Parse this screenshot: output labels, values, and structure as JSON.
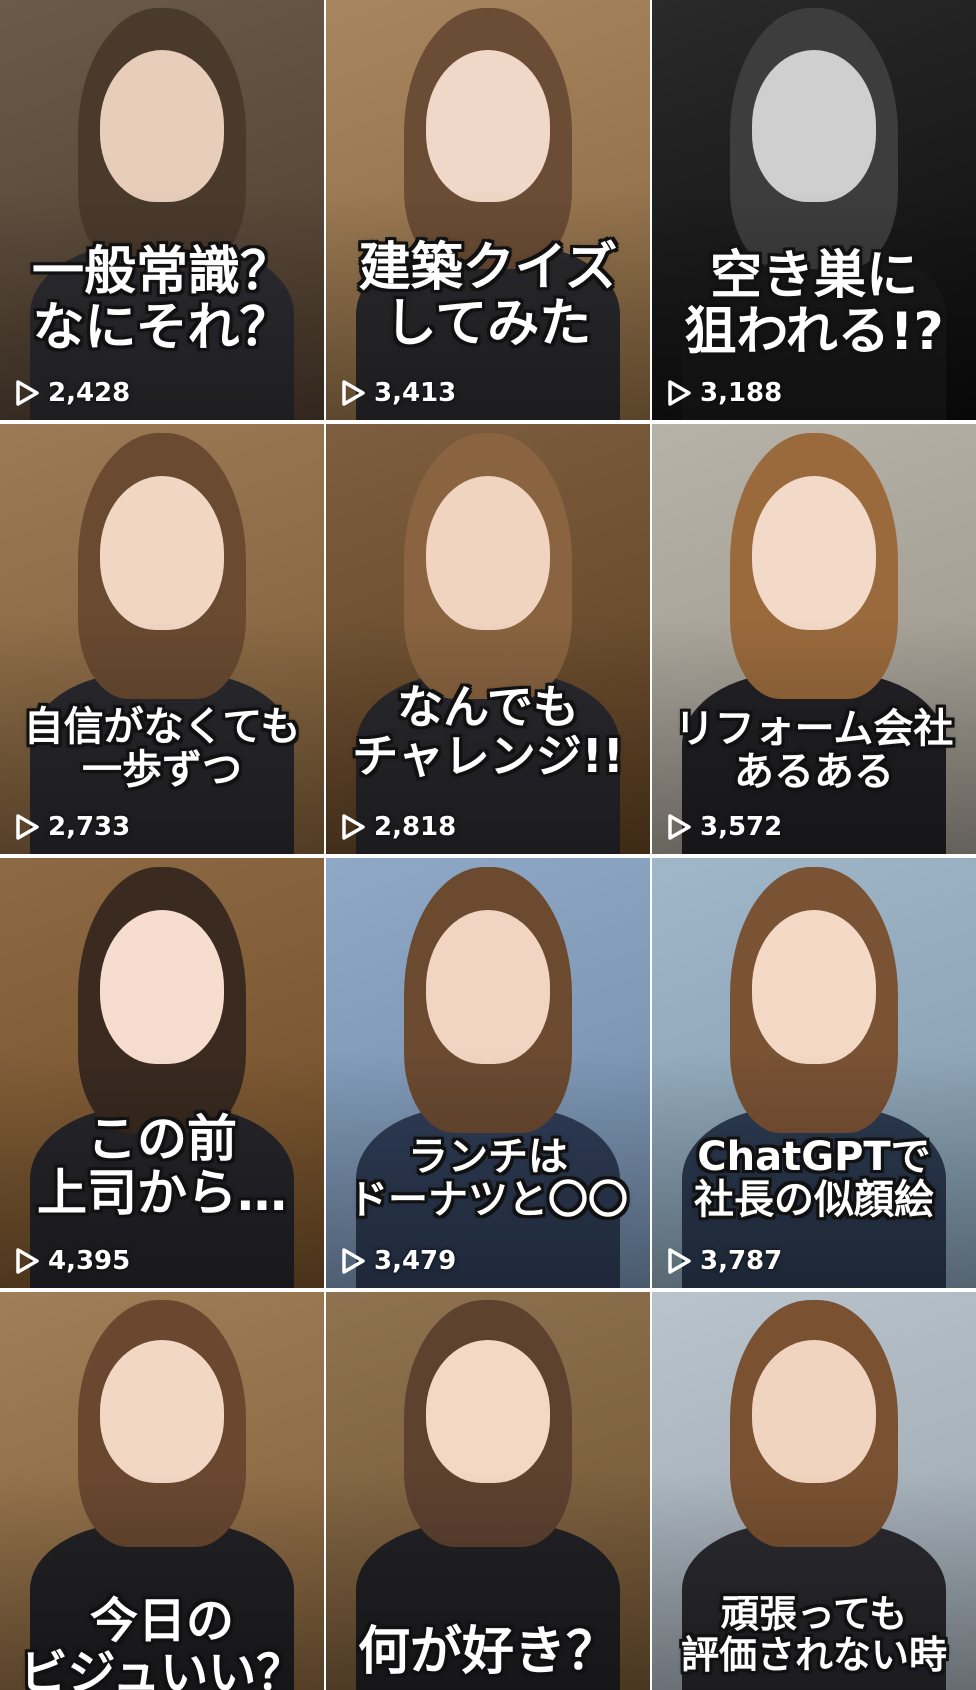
{
  "videos": [
    {
      "caption": [
        "一般常識？",
        "なにそれ？"
      ],
      "views": "2,428",
      "bg": "#6b5a4a",
      "hair": "#4a3a2c",
      "skin": "#e8cdbb",
      "shirt": "#2e2e33",
      "grayscale": false
    },
    {
      "caption": [
        "建築クイズ",
        "してみた"
      ],
      "views": "3,413",
      "bg": "#a7865f",
      "hair": "#6b4d35",
      "skin": "#f0d8c8",
      "shirt": "#2b2a2e",
      "grayscale": false
    },
    {
      "caption": [
        "空き巣に",
        "狙われる!?"
      ],
      "views": "3,188",
      "bg": "#2a2a2a",
      "hair": "#3d3d3d",
      "skin": "#cfcfcf",
      "shirt": "#1a1a1a",
      "grayscale": true
    },
    {
      "caption": [
        "自信がなくても",
        "一歩ずつ"
      ],
      "views": "2,733",
      "bg": "#9b7a55",
      "hair": "#6a4a30",
      "skin": "#f1d6c4",
      "shirt": "#2a2a2f",
      "grayscale": false
    },
    {
      "caption": [
        "なんでも",
        "チャレンジ!!"
      ],
      "views": "2,818",
      "bg": "#7d5e3f",
      "hair": "#8a6440",
      "skin": "#f0d4c0",
      "shirt": "#2a2a2f",
      "grayscale": false
    },
    {
      "caption": [
        "リフォーム会社",
        "あるある"
      ],
      "views": "3,572",
      "bg": "#b7b2a8",
      "hair": "#9a6a3c",
      "skin": "#f2d9c8",
      "shirt": "#222226",
      "grayscale": false
    },
    {
      "caption": [
        "この前",
        "上司から…"
      ],
      "views": "4,395",
      "bg": "#8e6a44",
      "hair": "#3a2a20",
      "skin": "#f6ddd0",
      "shirt": "#26262b",
      "grayscale": false
    },
    {
      "caption": [
        "ランチは",
        "ドーナツと〇〇"
      ],
      "views": "3,479",
      "bg": "#8fa8c6",
      "hair": "#6b4a30",
      "skin": "#f1d5c2",
      "shirt": "#2f3d57",
      "grayscale": false
    },
    {
      "caption": [
        "ChatGPTで",
        "社長の似顔絵"
      ],
      "views": "3,787",
      "bg": "#9fb7c9",
      "hair": "#7a5234",
      "skin": "#f3d9c6",
      "shirt": "#2c3b52",
      "grayscale": false
    },
    {
      "caption": [
        "今日の",
        "ビジュいい？"
      ],
      "views": "",
      "bg": "#a07e58",
      "hair": "#6a4830",
      "skin": "#f2d7c5",
      "shirt": "#222226",
      "grayscale": false
    },
    {
      "caption": [
        "何が好き？"
      ],
      "views": "",
      "bg": "#8f7250",
      "hair": "#5e4230",
      "skin": "#f3d8c6",
      "shirt": "#222226",
      "grayscale": false
    },
    {
      "caption": [
        "頑張っても",
        "評価されない時"
      ],
      "views": "",
      "bg": "#b9c3cc",
      "hair": "#7a5232",
      "skin": "#f0d4c0",
      "shirt": "#2b2b30",
      "grayscale": false
    }
  ],
  "icons": {
    "play": "play-outline-icon"
  }
}
